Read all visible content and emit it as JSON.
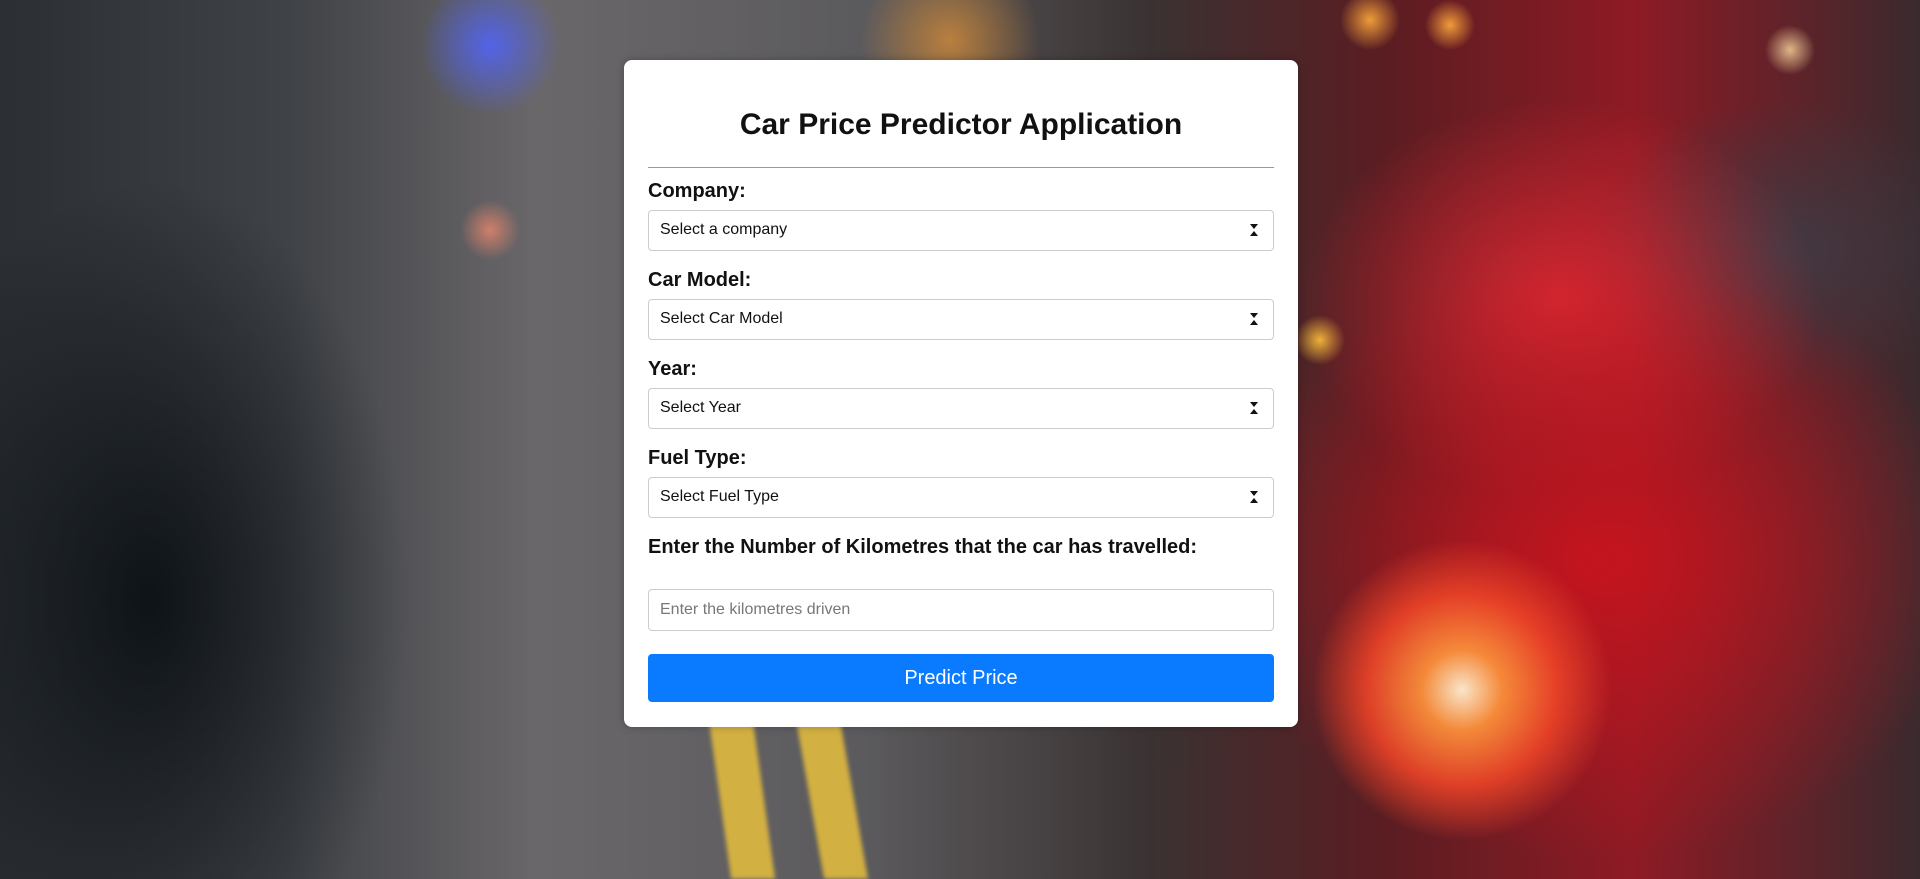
{
  "form": {
    "title": "Car Price Predictor Application",
    "company": {
      "label": "Company:",
      "selected": "Select a company"
    },
    "car_model": {
      "label": "Car Model:",
      "selected": "Select Car Model"
    },
    "year": {
      "label": "Year:",
      "selected": "Select Year"
    },
    "fuel_type": {
      "label": "Fuel Type:",
      "selected": "Select Fuel Type"
    },
    "kilometres": {
      "label": "Enter the Number of Kilometres that the car has travelled:",
      "placeholder": "Enter the kilometres driven",
      "value": ""
    },
    "submit_label": "Predict Price"
  },
  "colors": {
    "accent": "#0a7bff"
  },
  "icons": {
    "select_arrow": "up-down-arrow-icon"
  }
}
